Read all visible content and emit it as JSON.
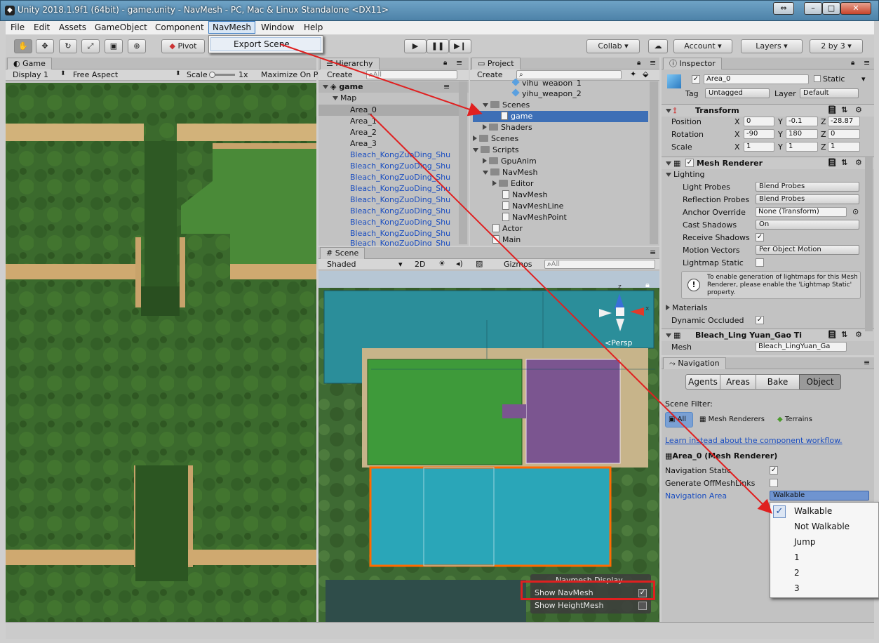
{
  "window": {
    "title": "Unity 2018.1.9f1 (64bit) - game.unity - NavMesh - PC, Mac & Linux Standalone <DX11>"
  },
  "menu": [
    "File",
    "Edit",
    "Assets",
    "GameObject",
    "Component",
    "NavMesh",
    "Window",
    "Help"
  ],
  "navmenu": {
    "export": "Export Scene"
  },
  "toolbar": {
    "pivot": "Pivot",
    "collab": "Collab",
    "account": "Account",
    "layers": "Layers",
    "layout": "2 by 3"
  },
  "game": {
    "tab": "Game",
    "display": "Display 1",
    "aspect": "Free Aspect",
    "scale_label": "Scale",
    "scale_val": "1x",
    "maximize": "Maximize On Pl"
  },
  "hierarchy": {
    "tab": "Hierarchy",
    "create": "Create",
    "search": "All",
    "root": "game",
    "items": [
      "Map",
      "Area_0",
      "Area_1",
      "Area_2",
      "Area_3",
      "Bleach_KongZuoDing_Shu",
      "Bleach_KongZuoDing_Shu",
      "Bleach_KongZuoDing_Shu",
      "Bleach_KongZuoDing_Shu",
      "Bleach_KongZuoDing_Shu",
      "Bleach_KongZuoDing_Shu",
      "Bleach_KongZuoDing_Shu",
      "Bleach_KongZuoDing_Shu",
      "Bleach_KongZuoDing_Shu"
    ]
  },
  "project": {
    "tab": "Project",
    "create": "Create",
    "items": [
      "yihu_weapon_1",
      "yihu_weapon_2",
      "Scenes",
      "game",
      "Shaders",
      "Scenes",
      "Scripts",
      "GpuAnim",
      "NavMesh",
      "Editor",
      "NavMesh",
      "NavMeshLine",
      "NavMeshPoint",
      "Actor",
      "Main"
    ]
  },
  "scene": {
    "tab": "Scene",
    "shaded": "Shaded",
    "mode2d": "2D",
    "gizmos": "Gizmos",
    "search": "All",
    "persp": "Persp",
    "axis_x": "x",
    "axis_z": "z",
    "navdisplay": "Navmesh Display",
    "show_navmesh": "Show NavMesh",
    "show_height": "Show HeightMesh"
  },
  "inspector": {
    "tab": "Inspector",
    "name": "Area_0",
    "static": "Static",
    "tag_label": "Tag",
    "tag": "Untagged",
    "layer_label": "Layer",
    "layer": "Default",
    "transform": "Transform",
    "position": "Position",
    "rotation": "Rotation",
    "scale": "Scale",
    "pos": [
      "0",
      "-0.1",
      "-28.87"
    ],
    "rot": [
      "-90",
      "180",
      "0"
    ],
    "scl": [
      "1",
      "1",
      "1"
    ],
    "ax": [
      "X",
      "Y",
      "Z"
    ],
    "mesh_renderer": "Mesh Renderer",
    "lighting": "Lighting",
    "props": [
      {
        "k": "Light Probes",
        "v": "Blend Probes"
      },
      {
        "k": "Reflection Probes",
        "v": "Blend Probes"
      },
      {
        "k": "Anchor Override",
        "v": "None (Transform)"
      },
      {
        "k": "Cast Shadows",
        "v": "On"
      },
      {
        "k": "Receive Shadows",
        "v": ""
      },
      {
        "k": "Motion Vectors",
        "v": "Per Object Motion"
      },
      {
        "k": "Lightmap Static",
        "v": ""
      }
    ],
    "info": "To enable generation of lightmaps for this Mesh Renderer, please enable the 'Lightmap Static' property.",
    "materials": "Materials",
    "dyn_occ": "Dynamic Occluded",
    "mesh_filter": "Bleach_Ling Yuan_Gao Ti",
    "mesh_label": "Mesh",
    "mesh_val": "Bleach_LingYuan_Ga"
  },
  "navigation": {
    "tab": "Navigation",
    "tabs": [
      "Agents",
      "Areas",
      "Bake",
      "Object"
    ],
    "scene_filter": "Scene Filter:",
    "filters": [
      "All",
      "Mesh Renderers",
      "Terrains"
    ],
    "link": "Learn instead about the component workflow.",
    "object": "Area_0 (Mesh Renderer)",
    "nav_static": "Navigation Static",
    "offmesh": "Generate OffMeshLinks",
    "nav_area": "Navigation Area",
    "area_val": "Walkable"
  },
  "area_menu": [
    "Walkable",
    "Not Walkable",
    "Jump",
    "1",
    "2",
    "3"
  ],
  "colors": {
    "accent": "#e02020",
    "walkable": "#2aa6b8",
    "jump": "#8a5fa0"
  }
}
